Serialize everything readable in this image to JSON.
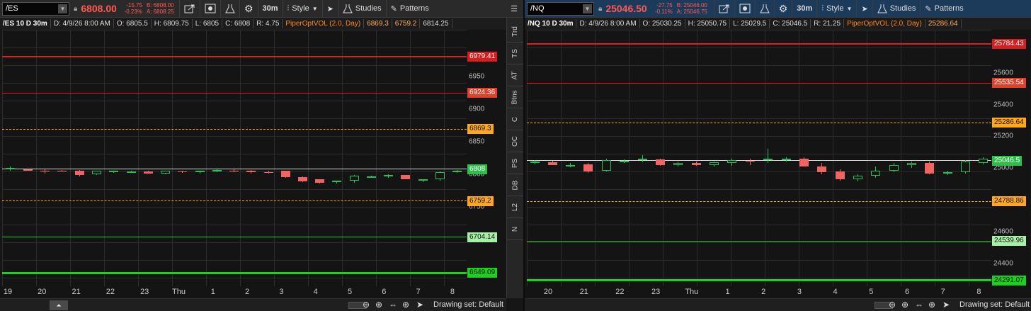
{
  "left": {
    "symbol": "/ES",
    "price": "6808.00",
    "change": "-15.75",
    "change_pct": "-0.23%",
    "bid": "B: 6808.00",
    "ask": "A: 6808.25",
    "timeframe": "30m",
    "style_label": "Style",
    "studies_label": "Studies",
    "patterns_label": "Patterns",
    "info": {
      "title": "/ES 10 D 30m",
      "date": "D: 4/9/26 8:00 AM",
      "open": "O: 6805.5",
      "high": "H: 6809.75",
      "low": "L: 6805",
      "close": "C: 6808",
      "range": "R: 4.75",
      "study": "PiperOptVOL (2.0, Day)",
      "study_v1": "6869.3",
      "study_v2": "6759.2",
      "study_v3": "6814.25"
    },
    "price_ticks": [
      "6950",
      "6900",
      "6850",
      "6800",
      "6750",
      "6700"
    ],
    "price_tags": [
      "6979.41",
      "6924.36",
      "6869.3",
      "6808",
      "6759.2",
      "6704.14",
      "6649.09"
    ],
    "x_labels": [
      "19",
      "20",
      "21",
      "22",
      "23",
      "Thu",
      "1",
      "2",
      "3",
      "4",
      "5",
      "6",
      "7",
      "8"
    ],
    "drawing_set": "Drawing set: Default"
  },
  "right": {
    "symbol": "/NQ",
    "price": "25046.50",
    "change": "-27.75",
    "change_pct": "-0.11%",
    "bid": "B: 25046.00",
    "ask": "A: 25046.75",
    "timeframe": "30m",
    "style_label": "Style",
    "studies_label": "Studies",
    "patterns_label": "Patterns",
    "info": {
      "title": "/NQ 10 D 30m",
      "date": "D: 4/9/26 8:00 AM",
      "open": "O: 25030.25",
      "high": "H: 25050.75",
      "low": "L: 25029.5",
      "close": "C: 25046.5",
      "range": "R: 21.25",
      "study": "PiperOptVOL (2.0, Day)",
      "study_v1": "25286.64"
    },
    "price_ticks": [
      "25600",
      "25400",
      "25200",
      "25000",
      "24800",
      "24600",
      "24400"
    ],
    "price_tags": [
      "25784.43",
      "25535.54",
      "25286.64",
      "25046.5",
      "24788.86",
      "24539.96",
      "24291.07"
    ],
    "x_labels": [
      "20",
      "21",
      "22",
      "23",
      "Thu",
      "1",
      "2",
      "3",
      "4",
      "5",
      "6",
      "7",
      "8"
    ],
    "drawing_set": "Drawing set: Default"
  },
  "sidebar_tabs": [
    "Trd",
    "TS",
    "AT",
    "Btns",
    "C",
    "OC",
    "PS",
    "DB",
    "L2",
    "N"
  ],
  "colors": {
    "red_line": "#e01e1e",
    "orange_dash": "#ffb000",
    "green_line": "#1ed01e",
    "up": "#22c45a",
    "down": "#f06464"
  }
}
